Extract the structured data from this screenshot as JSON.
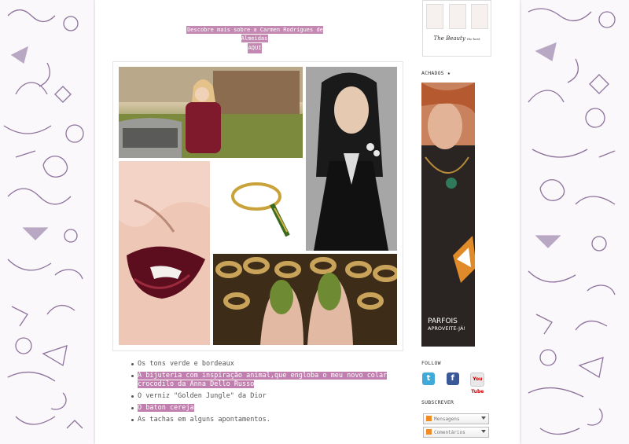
{
  "header": {
    "note_line1": "Descobre mais sobre a Carmen Rodrigues de Almeidas",
    "note_link": "AQUI"
  },
  "post": {
    "bullets": [
      {
        "text": "Os tons verde e bordeaux",
        "highlight": false
      },
      {
        "text": "A bijuteria com inspiração animal,que engloba o meu novo colar crocodilo da Anna Dello Russo",
        "highlight": true
      },
      {
        "text": "O verniz \"Golden Jungle\" da Dior",
        "highlight": false
      },
      {
        "text": "O baton cereja",
        "highlight": true
      },
      {
        "text": "As tachas em alguns apontamentos.",
        "highlight": false
      }
    ]
  },
  "sidebar": {
    "beauty_logo": "The Beauty",
    "beauty_logo_sub": "the best",
    "achados_title": "ACHADOS ★",
    "ad_line1": "PARFOIS",
    "ad_line2": "APROVEITE-JÁ!",
    "follow_title": "FOLLOW",
    "subscribe_title": "SUBSCREVER",
    "subscribe_items": [
      "Mensagens",
      "Comentários"
    ],
    "youtube_label": "You Tube"
  },
  "colors": {
    "highlight": "#c07fae",
    "note_bg": "#c489b3",
    "pattern": "#7a5b8c"
  }
}
